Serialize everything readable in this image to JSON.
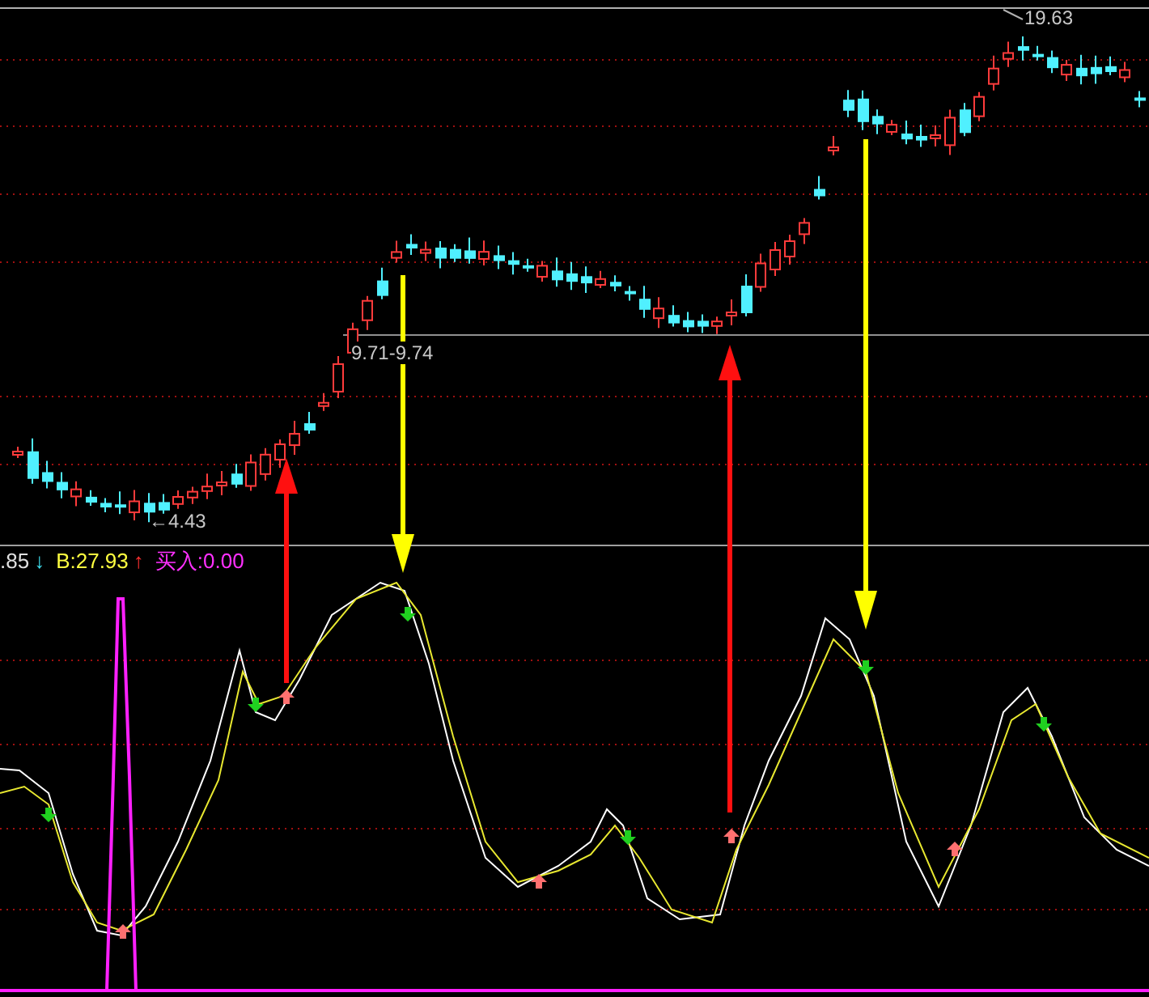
{
  "price_chart": {
    "high_label": "19.63",
    "range_label": "9.71-9.74",
    "low_label": "←4.43"
  },
  "indicator_legend": [
    {
      "kind": "value",
      "text": ".85",
      "color": "#e0e0e0"
    },
    {
      "kind": "arrow",
      "text": "↓",
      "color": "#40e0f0"
    },
    {
      "kind": "value",
      "text": "B:27.93",
      "color": "#ffff40"
    },
    {
      "kind": "arrow",
      "text": "↑",
      "color": "#ff3030"
    },
    {
      "kind": "value",
      "text": "买入:0.00",
      "color": "#ff30ff"
    }
  ]
}
